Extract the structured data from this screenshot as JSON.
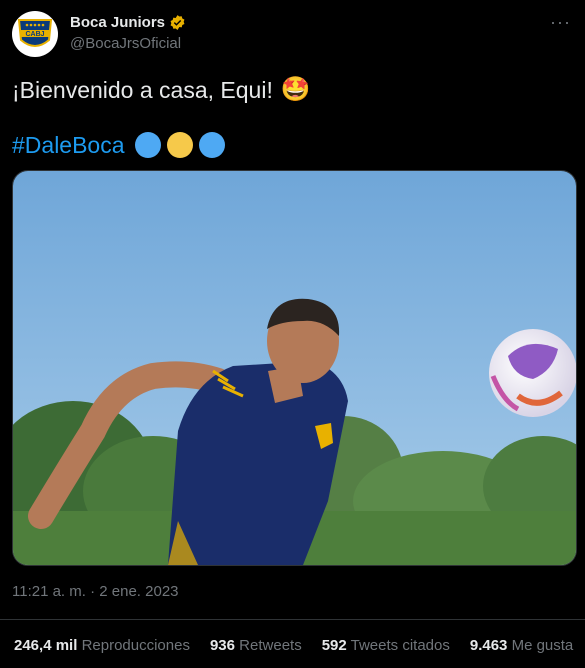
{
  "author": {
    "name": "Boca Juniors",
    "handle": "@BocaJrsOficial",
    "logo_text": "CABJ",
    "verified_color": "#e8b100"
  },
  "tweet": {
    "text": "¡Bienvenido a casa, Equi!",
    "emoji": "🤩",
    "hashtag": "#DaleBoca",
    "circle_colors": [
      "#4ea9f3",
      "#f6c94a",
      "#4ea9f3"
    ],
    "timestamp": "11:21 a. m. · 2 ene. 2023"
  },
  "stats": [
    {
      "value": "246,4 mil",
      "label": "Reproducciones"
    },
    {
      "value": "936",
      "label": "Retweets"
    },
    {
      "value": "592",
      "label": "Tweets citados"
    },
    {
      "value": "9.463",
      "label": "Me gusta"
    }
  ],
  "colors": {
    "background": "#000000",
    "text": "#e7e9ea",
    "muted": "#71767b",
    "link": "#1d9bf0",
    "border": "#2f3336"
  }
}
